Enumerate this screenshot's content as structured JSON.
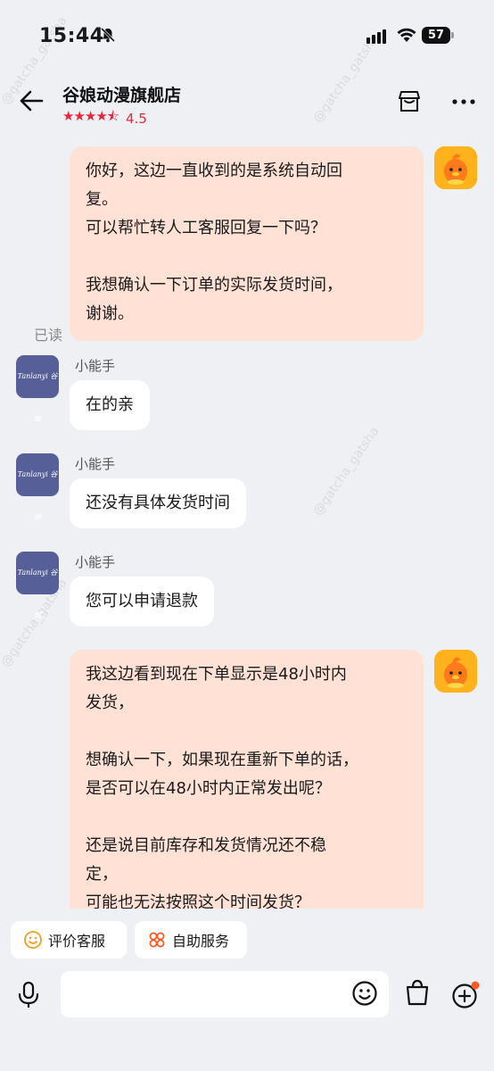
{
  "status": {
    "time": "15:44",
    "battery": "57"
  },
  "header": {
    "title": "谷娘动漫旗舰店",
    "stars": "★★★★⯪",
    "rating": "4.5"
  },
  "messages": {
    "m1": {
      "lines": [
        "你好，这边一直收到的是系统自动回",
        "复。",
        "可以帮忙转人工客服回复一下吗？",
        "",
        "我想确认一下订单的实际发货时间，",
        "谢谢。"
      ]
    },
    "read": "已读",
    "sender": "小能手",
    "store_avatar": "Tanlanyi 谷娘",
    "m2": "在的亲",
    "m3": "还没有具体发货时间",
    "m4": "您可以申请退款",
    "m5": {
      "lines": [
        "我这边看到现在下单显示是48小时内",
        "发货，",
        "",
        "想确认一下，如果现在重新下单的话，",
        "是否可以在48小时内正常发出呢？",
        "",
        "还是说目前库存和发货情况还不稳",
        "定，",
        "可能也无法按照这个时间发货？"
      ]
    }
  },
  "actions": {
    "rate": "评价客服",
    "self_service": "自助服务"
  },
  "watermark": "@gatcha_gatsha",
  "colors": {
    "accent": "#e8263b",
    "my_bubble": "#ffe1d6",
    "avatar_orange": "#ffb21c",
    "store_avatar": "#565f98",
    "notification_dot": "#ff5a1f"
  }
}
